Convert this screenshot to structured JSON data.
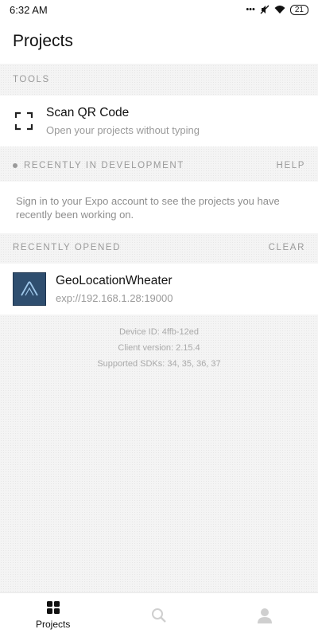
{
  "status_bar": {
    "time": "6:32 AM",
    "battery": "21"
  },
  "header": {
    "title": "Projects"
  },
  "tools": {
    "section_title": "TOOLS",
    "scan": {
      "title": "Scan QR Code",
      "subtitle": "Open your projects without typing",
      "icon": "qr-scan-icon"
    }
  },
  "development": {
    "section_title": "RECENTLY IN DEVELOPMENT",
    "help_label": "HELP",
    "message": "Sign in to your Expo account to see the projects you have recently been working on."
  },
  "recent": {
    "section_title": "RECENTLY OPENED",
    "clear_label": "CLEAR",
    "project": {
      "name": "GeoLocationWheater",
      "url": "exp://192.168.1.28:19000",
      "icon": "expo-app-icon",
      "icon_color": "#2f4e6f"
    }
  },
  "device_info": {
    "device_id": "Device ID: 4ffb-12ed",
    "client_version": "Client version: 2.15.4",
    "sdks": "Supported SDKs: 34, 35, 36, 37"
  },
  "tab_bar": {
    "projects_label": "Projects",
    "tabs": [
      "grid-icon",
      "search-icon",
      "profile-icon"
    ]
  }
}
